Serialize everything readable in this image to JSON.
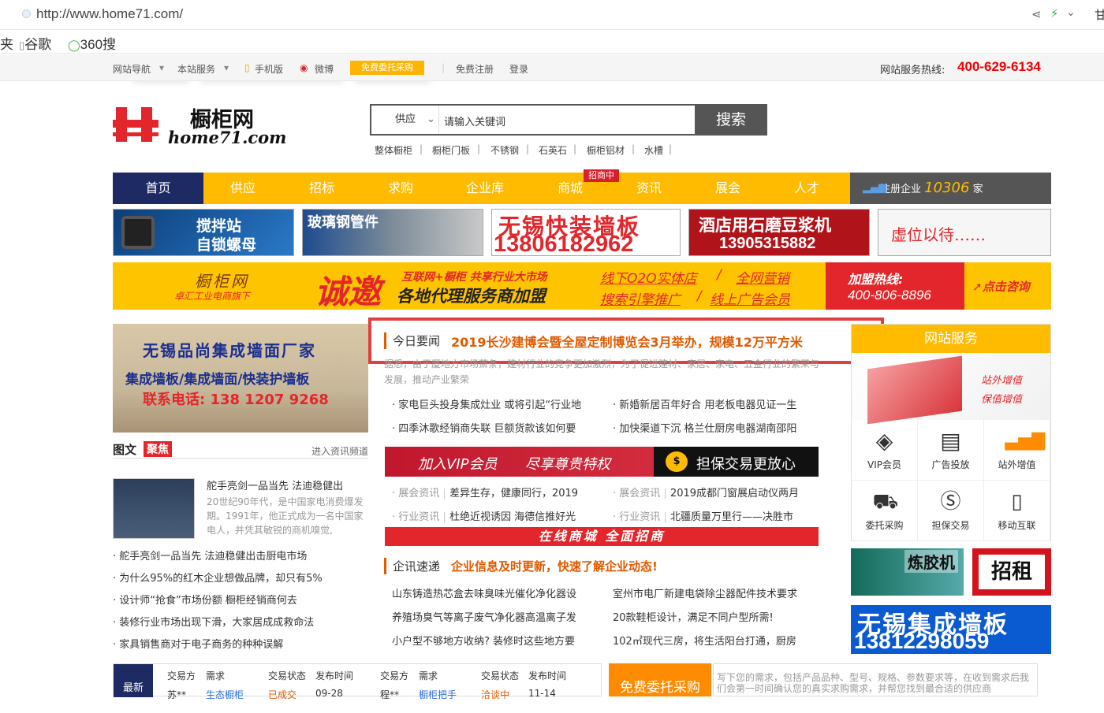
{
  "browser": {
    "url": "http://www.home71.com/",
    "bookmarks": [
      "夹",
      "谷歌",
      "360搜"
    ],
    "tail": "甘"
  },
  "topnav": {
    "items": [
      "网站导航",
      "本站服务",
      "手机版",
      "微博",
      "免费委托采购",
      "免费注册",
      "登录"
    ],
    "hotline_label": "网站服务热线:",
    "hotline": "400-629-6134"
  },
  "logo": {
    "cn": "橱柜网",
    "en": "home71.com"
  },
  "search": {
    "category": "供应",
    "placeholder": "请输入关键词",
    "button": "搜索",
    "keywords": [
      "整体橱柜",
      "橱柜门板",
      "不锈钢",
      "石英石",
      "橱柜铝材",
      "水槽"
    ]
  },
  "mainnav": {
    "items": [
      "首页",
      "供应",
      "招标",
      "求购",
      "企业库",
      "商城",
      "资讯",
      "展会",
      "人才"
    ],
    "badge": "招商中",
    "reg_label": "注册企业",
    "reg_count": "10306",
    "reg_unit": "家"
  },
  "ads": {
    "a1": [
      "搅拌站",
      "自锁螺母"
    ],
    "a2": "玻璃钢管件",
    "a3": [
      "无锡快装墙板",
      "13806182962"
    ],
    "a4": [
      "酒店用石磨豆浆机",
      "13905315882"
    ],
    "a5": "虚位以待……"
  },
  "banner": {
    "brand": "橱柜网",
    "sub": "卓汇工业电商旗下",
    "big": "诚邀",
    "line1": "互联网+橱柜 共享行业大市场",
    "line2": "各地代理服务商加盟",
    "l3": "线下O2O实体店",
    "l4": "全网营销",
    "l5": "搜索引擎推广",
    "l6": "线上广告会员",
    "hot_label": "加盟热线:",
    "hot": "400-806-8896",
    "consult": "点击咨询"
  },
  "leftimg": {
    "title": "无锡品尚集成墙面厂家",
    "sub": "集成墙板/集成墙面/快装护墙板",
    "phone": "联系电话: 138 1207 9268"
  },
  "tuwen": {
    "title": "图文",
    "tag": "聚焦",
    "more": "进入资讯频道",
    "feat_title": "舵手亮剑一品当先 法迪稳健出",
    "feat_desc": "20世纪90年代，是中国家电消费爆发期。1991年，他正式成为一名中国家电人，并凭其敏锐的商机嗅觉,",
    "list": [
      "舵手亮剑一品当先 法迪稳健出击厨电市场",
      "为什么95%的红木企业想做品牌，却只有5%",
      "设计师“抢食”市场份额 橱柜经销商何去",
      "装修行业市场出现下滑，大家居成成救命法",
      "家具销售商对于电子商务的种种误解"
    ]
  },
  "today": {
    "label": "今日要闻",
    "main": "2019长沙建博会暨全屋定制博览会3月举办，规模12万平方米",
    "desc": "据悉，由于厦地方市场萧条，建材行业的竞争更加激烈，为了促进建材、家居、家电、五金行业的繁荣与发展，推动产业繁荣",
    "news": [
      "家电巨头投身集成灶业 或将引起“行业地",
      "新婚新居百年好合 用老板电器见证一生",
      "四季沐歌经销商失联 巨额货款该如何要",
      "加快渠道下沉 格兰仕厨房电器湖南邵阳"
    ]
  },
  "vip": {
    "a": "加入VIP会员",
    "b": "尽享尊贵特权",
    "c": "担保交易更放心"
  },
  "tagged": [
    {
      "tag": "展会资讯",
      "text": "差异生存，健康同行，2019"
    },
    {
      "tag": "展会资讯",
      "text": "2019成都门窗展启动仪两月"
    },
    {
      "tag": "行业资讯",
      "text": "杜绝近视诱因 海德信推好光"
    },
    {
      "tag": "行业资讯",
      "text": "北疆质量万里行——决胜市"
    }
  ],
  "mall": "在线商城   全面招商",
  "qiye": {
    "label": "企讯速递",
    "main": "企业信息及时更新，快速了解企业动态!",
    "items": [
      "山东铸造热芯盒去味臭味光催化净化器设",
      "室州市电厂新建电袋除尘器配件技术要求",
      "养殖场臭气等离子废气净化器高温离子发",
      "20款鞋柜设计，满足不同户型所需!",
      "小户型不够地方收纳? 装修时这些地方要",
      "102㎡现代三房，将生活阳台打通，厨房"
    ]
  },
  "service": {
    "title": "网站服务",
    "promo1": "站外增值",
    "promo2": "保值增值",
    "items": [
      "VIP会员",
      "广告投放",
      "站外增值",
      "委托采购",
      "担保交易",
      "移动互联"
    ]
  },
  "sideads": {
    "a6": "炼胶机",
    "a7": "招租",
    "a8": [
      "无锡集成墙板",
      "13812298059"
    ]
  },
  "trade": {
    "side": "最新",
    "headers": [
      "交易方",
      "需求",
      "交易状态",
      "发布时间",
      "交易方",
      "需求",
      "交易状态",
      "发布时间"
    ],
    "row": [
      "苏**",
      "生态橱柜",
      "已成交",
      "09-28",
      "程**",
      "橱柜把手",
      "洽谈中",
      "11-14"
    ]
  },
  "free": {
    "title": "免费委托采购",
    "placeholder": "写下您的需求，包括产品品种、型号、规格、参数要求等，在收到需求后我们会第一时间确认您的真实求购需求，并帮您找到最合适的供应商"
  }
}
